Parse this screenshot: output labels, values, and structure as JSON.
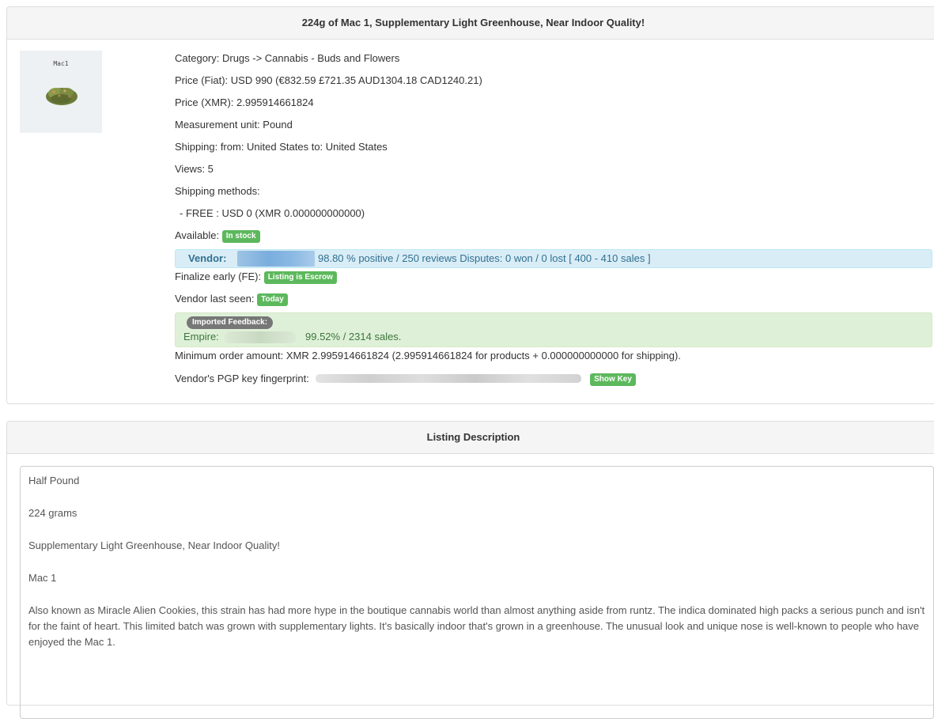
{
  "listing": {
    "title": "224g of Mac 1, Supplementary Light Greenhouse, Near Indoor Quality!",
    "image_label": "Mac1",
    "category": "Category: Drugs -> Cannabis - Buds and Flowers",
    "price_fiat": "Price (Fiat): USD 990 (€832.59 £721.35 AUD1304.18 CAD1240.21)",
    "price_xmr": "Price (XMR): 2.995914661824",
    "measurement": "Measurement unit: Pound",
    "shipping": "Shipping: from: United States to: United States",
    "views": "Views: 5",
    "shipping_methods_label": "Shipping methods:",
    "shipping_method_1": "- FREE : USD 0 (XMR 0.000000000000)",
    "available_label": "Available:",
    "available_badge": "In stock",
    "vendor_label": "Vendor:",
    "vendor_stats": "98.80 % positive / 250 reviews Disputes: 0 won / 0 lost [ 400 - 410 sales ]",
    "fe_label": "Finalize early (FE):",
    "fe_badge": "Listing is Escrow",
    "last_seen_label": "Vendor last seen:",
    "last_seen_badge": "Today",
    "imported_feedback_badge": "Imported Feedback:",
    "imported_market": "Empire:",
    "imported_stats": "99.52% / 2314 sales.",
    "min_order": "Minimum order amount: XMR 2.995914661824 (2.995914661824 for products + 0.000000000000 for shipping).",
    "pgp_label": "Vendor's PGP key fingerprint:",
    "show_key": "Show Key"
  },
  "description": {
    "heading": "Listing Description",
    "paragraphs": [
      "Half Pound",
      "224 grams",
      "Supplementary Light Greenhouse, Near Indoor Quality!",
      "Mac 1",
      "Also known as Miracle Alien Cookies, this strain has had more hype in the boutique cannabis world than almost anything aside from runtz. The indica dominated high packs a serious punch and isn't for the faint of heart. This limited batch was grown with supplementary lights. It's basically indoor that's grown in a greenhouse. The unusual look and unique nose is well-known to people who have enjoyed the Mac 1."
    ]
  },
  "colors": {
    "success": "#5cb85c",
    "info_bg": "#d9edf7",
    "info_text": "#31708f",
    "feedback_bg": "#dff0d8",
    "feedback_text": "#3c763d"
  }
}
